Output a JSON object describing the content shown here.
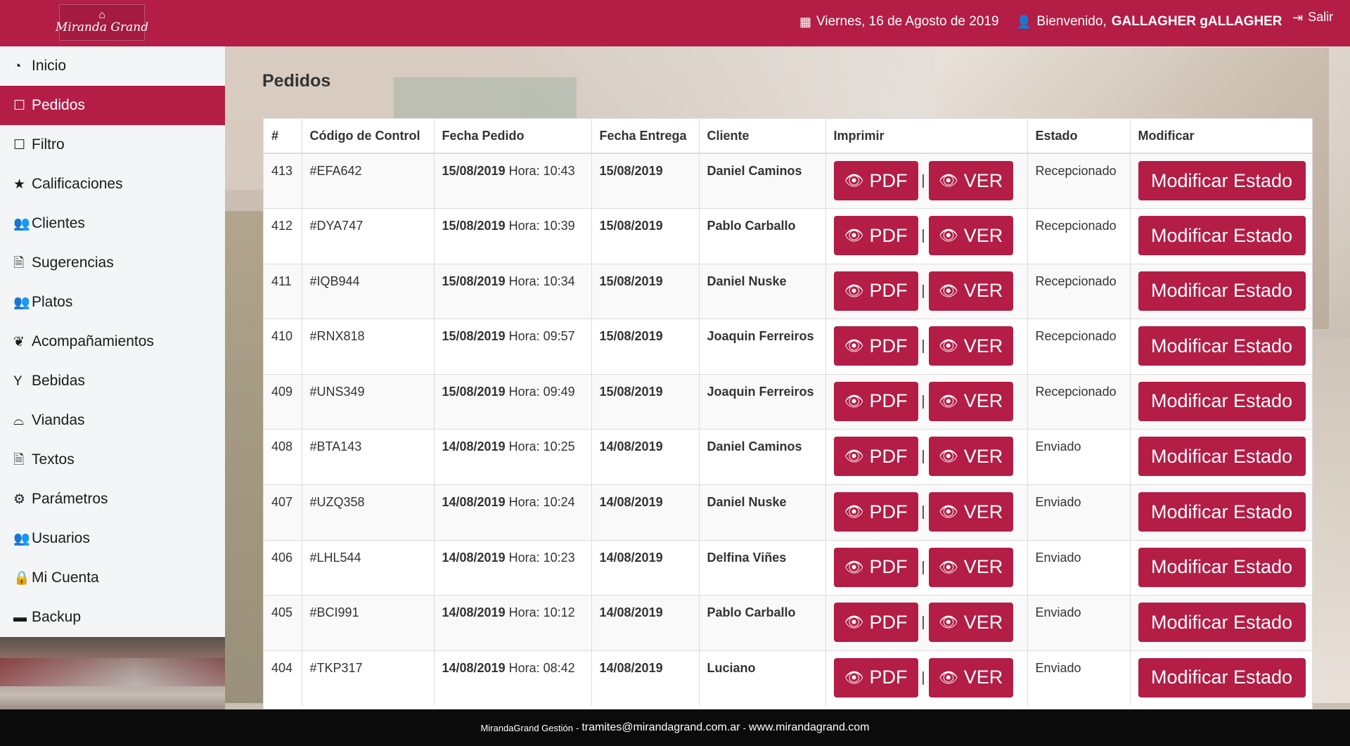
{
  "header": {
    "logo_text": "Miranda Grand",
    "logo_icon": "cloche-icon",
    "date": "Viernes, 16 de Agosto de 2019",
    "welcome_prefix": "Bienvenido,",
    "user_name": "GALLAGHER gALLAGHER",
    "logout_label": "Salir"
  },
  "colors": {
    "brand": "#b31d46",
    "footer": "#0b0b0b",
    "sidebar_bg": "#f3f5f7"
  },
  "sidebar": {
    "items": [
      {
        "label": "Inicio",
        "icon": "dashboard-icon",
        "active": false
      },
      {
        "label": "Pedidos",
        "icon": "edit-icon",
        "active": true
      },
      {
        "label": "Filtro",
        "icon": "edit-icon",
        "active": false
      },
      {
        "label": "Calificaciones",
        "icon": "star-icon",
        "active": false
      },
      {
        "label": "Clientes",
        "icon": "users-icon",
        "active": false
      },
      {
        "label": "Sugerencias",
        "icon": "file-text-icon",
        "active": false
      },
      {
        "label": "Platos",
        "icon": "users-icon",
        "active": false
      },
      {
        "label": "Acompañamientos",
        "icon": "leaf-icon",
        "active": false
      },
      {
        "label": "Bebidas",
        "icon": "glass-icon",
        "active": false
      },
      {
        "label": "Viandas",
        "icon": "inbox-icon",
        "active": false
      },
      {
        "label": "Textos",
        "icon": "file-text-icon",
        "active": false
      },
      {
        "label": "Parámetros",
        "icon": "gear-icon",
        "active": false
      },
      {
        "label": "Usuarios",
        "icon": "users-icon",
        "active": false
      },
      {
        "label": "Mi Cuenta",
        "icon": "lock-icon",
        "active": false
      },
      {
        "label": "Backup",
        "icon": "hdd-icon",
        "active": false
      }
    ]
  },
  "main": {
    "title": "Pedidos",
    "table": {
      "columns": [
        "#",
        "Código de Control",
        "Fecha Pedido",
        "Fecha Entrega",
        "Cliente",
        "Imprimir",
        "Estado",
        "Modificar"
      ],
      "hora_label": "Hora:",
      "pdf_label": "PDF",
      "ver_label": "VER",
      "separator": "|",
      "modify_label": "Modificar Estado",
      "rows": [
        {
          "id": "413",
          "code": "#EFA642",
          "fecha_pedido": "15/08/2019",
          "hora": "10:43",
          "fecha_entrega": "15/08/2019",
          "cliente": "Daniel Caminos",
          "estado": "Recepcionado"
        },
        {
          "id": "412",
          "code": "#DYA747",
          "fecha_pedido": "15/08/2019",
          "hora": "10:39",
          "fecha_entrega": "15/08/2019",
          "cliente": "Pablo Carballo",
          "estado": "Recepcionado"
        },
        {
          "id": "411",
          "code": "#IQB944",
          "fecha_pedido": "15/08/2019",
          "hora": "10:34",
          "fecha_entrega": "15/08/2019",
          "cliente": "Daniel Nuske",
          "estado": "Recepcionado"
        },
        {
          "id": "410",
          "code": "#RNX818",
          "fecha_pedido": "15/08/2019",
          "hora": "09:57",
          "fecha_entrega": "15/08/2019",
          "cliente": "Joaquin Ferreiros",
          "estado": "Recepcionado"
        },
        {
          "id": "409",
          "code": "#UNS349",
          "fecha_pedido": "15/08/2019",
          "hora": "09:49",
          "fecha_entrega": "15/08/2019",
          "cliente": "Joaquin Ferreiros",
          "estado": "Recepcionado"
        },
        {
          "id": "408",
          "code": "#BTA143",
          "fecha_pedido": "14/08/2019",
          "hora": "10:25",
          "fecha_entrega": "14/08/2019",
          "cliente": "Daniel Caminos",
          "estado": "Enviado"
        },
        {
          "id": "407",
          "code": "#UZQ358",
          "fecha_pedido": "14/08/2019",
          "hora": "10:24",
          "fecha_entrega": "14/08/2019",
          "cliente": "Daniel Nuske",
          "estado": "Enviado"
        },
        {
          "id": "406",
          "code": "#LHL544",
          "fecha_pedido": "14/08/2019",
          "hora": "10:23",
          "fecha_entrega": "14/08/2019",
          "cliente": "Delfina Viñes",
          "estado": "Enviado"
        },
        {
          "id": "405",
          "code": "#BCI991",
          "fecha_pedido": "14/08/2019",
          "hora": "10:12",
          "fecha_entrega": "14/08/2019",
          "cliente": "Pablo Carballo",
          "estado": "Enviado"
        },
        {
          "id": "404",
          "code": "#TKP317",
          "fecha_pedido": "14/08/2019",
          "hora": "08:42",
          "fecha_entrega": "14/08/2019",
          "cliente": "Luciano",
          "estado": "Enviado"
        }
      ]
    }
  },
  "footer": {
    "app_name": "MirandaGrand Gestión",
    "sep": "-",
    "email": "tramites@mirandagrand.com.ar",
    "website": "www.mirandagrand.com"
  }
}
